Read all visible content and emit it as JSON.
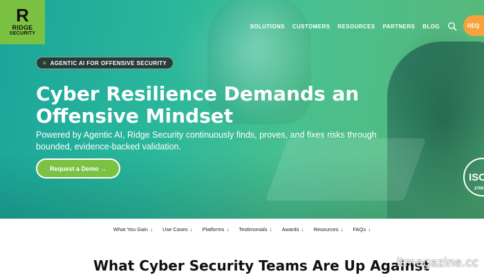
{
  "logo": {
    "mark": "R",
    "line1": "RIDGE",
    "line2": "SECURITY"
  },
  "nav": {
    "items": [
      "SOLUTIONS",
      "CUSTOMERS",
      "RESOURCES",
      "PARTNERS",
      "BLOG"
    ],
    "cta_peek": "REQ"
  },
  "hero": {
    "badge": "AGENTIC AI FOR OFFENSIVE SECURITY",
    "headline": "Cyber Resilience Demands an Offensive Mindset",
    "subtext": "Powered by Agentic AI, Ridge Security continuously finds, proves, and fixes risks through bounded, evidence-backed validation.",
    "button": "Request a Demo →",
    "iso_text": "ISO",
    "iso_num": "2700"
  },
  "subnav": {
    "items": [
      "What You Gain",
      "Use Cases",
      "Platforms",
      "Testimonials",
      "Awards",
      "Resources",
      "FAQs"
    ],
    "arrow": "↓"
  },
  "section": {
    "title": "What Cyber Security Teams Are Up Against"
  },
  "watermark": "itmagazine.cc",
  "colors": {
    "brand_green": "#7cc242",
    "cta_orange": "#f7a23b",
    "hero_teal": "#2bb79b"
  }
}
